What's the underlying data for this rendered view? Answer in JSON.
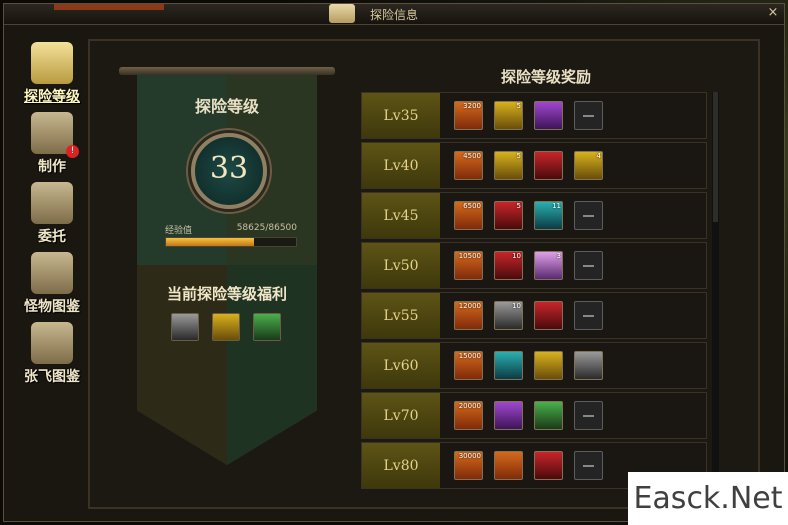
{
  "window": {
    "title": "探险信息",
    "close_icon": "×"
  },
  "sidebar": {
    "items": [
      {
        "label": "探险等级",
        "icon": "scroll-icon",
        "active": true
      },
      {
        "label": "制作",
        "icon": "anvil-icon",
        "badge": "!"
      },
      {
        "label": "委托",
        "icon": "envelope-icon"
      },
      {
        "label": "怪物图鉴",
        "icon": "monster-helmet-icon"
      },
      {
        "label": "张飞图鉴",
        "icon": "armor-icon"
      }
    ]
  },
  "banner": {
    "title": "探险等级",
    "level": "33",
    "exp_label": "经验值",
    "exp_value": "58625/86500",
    "exp_fraction": 0.678,
    "benefit_title": "当前探险等级福利",
    "benefit_icons": [
      "crossed-swords-icon",
      "treasure-map-icon",
      "green-gem-icon"
    ]
  },
  "rewards": {
    "title": "探险等级奖励",
    "rows": [
      {
        "level": "Lv35",
        "items": [
          {
            "type": "gold",
            "count": "3200"
          },
          {
            "type": "gems",
            "count": "5"
          },
          {
            "type": "purple"
          },
          {
            "type": "empty"
          }
        ]
      },
      {
        "level": "Lv40",
        "items": [
          {
            "type": "gold",
            "count": "4500"
          },
          {
            "type": "gems",
            "count": "5"
          },
          {
            "type": "red"
          },
          {
            "type": "gems",
            "count": "4"
          }
        ]
      },
      {
        "level": "Lv45",
        "items": [
          {
            "type": "gold",
            "count": "6500"
          },
          {
            "type": "red",
            "count": "5"
          },
          {
            "type": "blue",
            "count": "11"
          },
          {
            "type": "empty"
          }
        ]
      },
      {
        "level": "Lv50",
        "items": [
          {
            "type": "gold",
            "count": "10500"
          },
          {
            "type": "red",
            "count": "10"
          },
          {
            "type": "pink",
            "count": "3"
          },
          {
            "type": "empty"
          }
        ]
      },
      {
        "level": "Lv55",
        "items": [
          {
            "type": "gold",
            "count": "12000"
          },
          {
            "type": "gray",
            "count": "10"
          },
          {
            "type": "red"
          },
          {
            "type": "empty"
          }
        ]
      },
      {
        "level": "Lv60",
        "items": [
          {
            "type": "gold",
            "count": "15000"
          },
          {
            "type": "blue"
          },
          {
            "type": "gems"
          },
          {
            "type": "gray"
          }
        ]
      },
      {
        "level": "Lv70",
        "items": [
          {
            "type": "gold",
            "count": "20000"
          },
          {
            "type": "purple"
          },
          {
            "type": "green"
          },
          {
            "type": "empty"
          }
        ]
      },
      {
        "level": "Lv80",
        "items": [
          {
            "type": "gold",
            "count": "30000"
          },
          {
            "type": "gold"
          },
          {
            "type": "red"
          },
          {
            "type": "empty"
          }
        ]
      }
    ]
  },
  "watermark": "Easck.Net"
}
